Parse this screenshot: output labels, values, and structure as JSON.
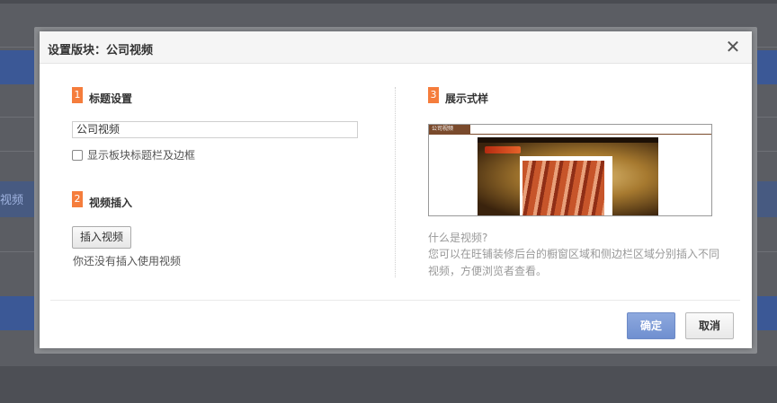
{
  "background": {
    "side_text": "视频"
  },
  "dialog": {
    "title": "设置版块：公司视频",
    "close_glyph": "✕",
    "sections": {
      "title_setting": {
        "number": "1",
        "label": "标题设置"
      },
      "video_insert": {
        "number": "2",
        "label": "视频插入"
      },
      "display_style": {
        "number": "3",
        "label": "展示式样"
      }
    },
    "title_input": {
      "value": "公司视频"
    },
    "show_border_checkbox": {
      "label": "显示板块标题栏及边框",
      "checked": false
    },
    "insert_button": "插入视频",
    "no_video_text": "你还没有插入使用视频",
    "preview": {
      "tab_label": "公司视频"
    },
    "description": {
      "question": "什么是视频?",
      "body": "您可以在旺铺装修后台的橱窗区域和侧边栏区域分别插入不同视频，方便浏览者查看。"
    },
    "ok_button": "确定",
    "cancel_button": "取消"
  },
  "colors": {
    "accent": "#f57d3c",
    "primary_button": "#7f9bd6"
  }
}
